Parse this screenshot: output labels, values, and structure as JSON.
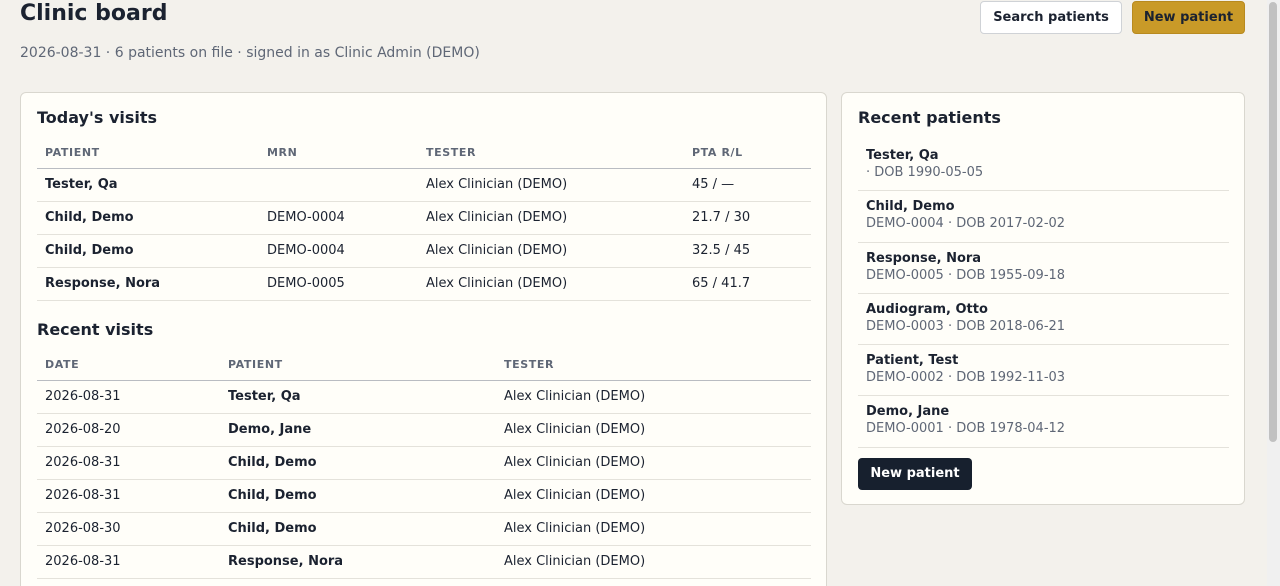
{
  "header": {
    "title": "Clinic board",
    "subtitle": "2026-08-31 · 6 patients on file · signed in as Clinic Admin (DEMO)",
    "search_label": "Search patients",
    "new_patient_label": "New patient"
  },
  "today": {
    "title": "Today's visits",
    "columns": [
      "PATIENT",
      "MRN",
      "TESTER",
      "PTA R/L"
    ],
    "rows": [
      {
        "patient": "Tester, Qa",
        "mrn": "",
        "tester": "Alex Clinician (DEMO)",
        "pta": "45 / —"
      },
      {
        "patient": "Child, Demo",
        "mrn": "DEMO-0004",
        "tester": "Alex Clinician (DEMO)",
        "pta": "21.7 / 30"
      },
      {
        "patient": "Child, Demo",
        "mrn": "DEMO-0004",
        "tester": "Alex Clinician (DEMO)",
        "pta": "32.5 / 45"
      },
      {
        "patient": "Response, Nora",
        "mrn": "DEMO-0005",
        "tester": "Alex Clinician (DEMO)",
        "pta": "65 / 41.7"
      }
    ]
  },
  "recent_visits": {
    "title": "Recent visits",
    "columns": [
      "DATE",
      "PATIENT",
      "TESTER"
    ],
    "rows": [
      {
        "date": "2026-08-31",
        "patient": "Tester, Qa",
        "tester": "Alex Clinician (DEMO)"
      },
      {
        "date": "2026-08-20",
        "patient": "Demo, Jane",
        "tester": "Alex Clinician (DEMO)"
      },
      {
        "date": "2026-08-31",
        "patient": "Child, Demo",
        "tester": "Alex Clinician (DEMO)"
      },
      {
        "date": "2026-08-31",
        "patient": "Child, Demo",
        "tester": "Alex Clinician (DEMO)"
      },
      {
        "date": "2026-08-30",
        "patient": "Child, Demo",
        "tester": "Alex Clinician (DEMO)"
      },
      {
        "date": "2026-08-31",
        "patient": "Response, Nora",
        "tester": "Alex Clinician (DEMO)"
      }
    ]
  },
  "recent_patients": {
    "title": "Recent patients",
    "items": [
      {
        "name": "Tester, Qa",
        "meta": "· DOB 1990-05-05"
      },
      {
        "name": "Child, Demo",
        "meta": "DEMO-0004 · DOB 2017-02-02"
      },
      {
        "name": "Response, Nora",
        "meta": "DEMO-0005 · DOB 1955-09-18"
      },
      {
        "name": "Audiogram, Otto",
        "meta": "DEMO-0003 · DOB 2018-06-21"
      },
      {
        "name": "Patient, Test",
        "meta": "DEMO-0002 · DOB 1992-11-03"
      },
      {
        "name": "Demo, Jane",
        "meta": "DEMO-0001 · DOB 1978-04-12"
      }
    ],
    "new_patient_label": "New patient"
  },
  "colors": {
    "accent": "#c99a28",
    "dark_button": "#17202e",
    "background": "#f3f1ec"
  }
}
